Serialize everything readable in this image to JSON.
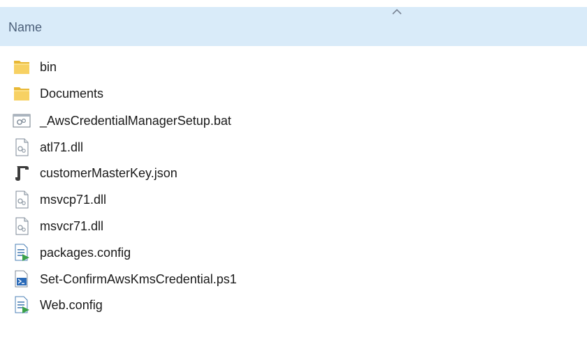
{
  "header": {
    "column_name": "Name",
    "sort_direction": "ascending"
  },
  "files": [
    {
      "name": "bin",
      "icon": "folder-icon"
    },
    {
      "name": "Documents",
      "icon": "folder-icon"
    },
    {
      "name": "_AwsCredentialManagerSetup.bat",
      "icon": "batch-file-icon"
    },
    {
      "name": "atl71.dll",
      "icon": "dll-file-icon"
    },
    {
      "name": "customerMasterKey.json",
      "icon": "json-file-icon"
    },
    {
      "name": "msvcp71.dll",
      "icon": "dll-file-icon"
    },
    {
      "name": "msvcr71.dll",
      "icon": "dll-file-icon"
    },
    {
      "name": "packages.config",
      "icon": "config-file-icon"
    },
    {
      "name": "Set-ConfirmAwsKmsCredential.ps1",
      "icon": "powershell-file-icon"
    },
    {
      "name": "Web.config",
      "icon": "config-file-icon"
    }
  ]
}
